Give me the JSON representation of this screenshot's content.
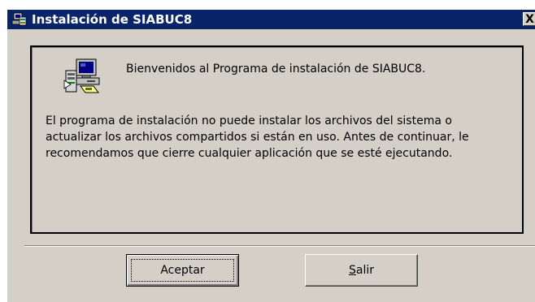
{
  "window": {
    "title": "Instalación de SIABUC8",
    "close_glyph": "X"
  },
  "dialog": {
    "icon": "setup-computer-icon",
    "welcome": "Bienvenidos al Programa de instalación de SIABUC8.",
    "message_lines": [
      "El programa de instalación no puede instalar los archivos del sistema o",
      "actualizar los archivos compartidos si están en uso. Antes de continuar, le",
      "recomendamos que cierre cualquier aplicación que se esté ejecutando."
    ]
  },
  "buttons": {
    "accept": "Aceptar",
    "exit": "Salir"
  },
  "colors": {
    "titlebar": "#0a246a",
    "face": "#d4d0c8"
  }
}
